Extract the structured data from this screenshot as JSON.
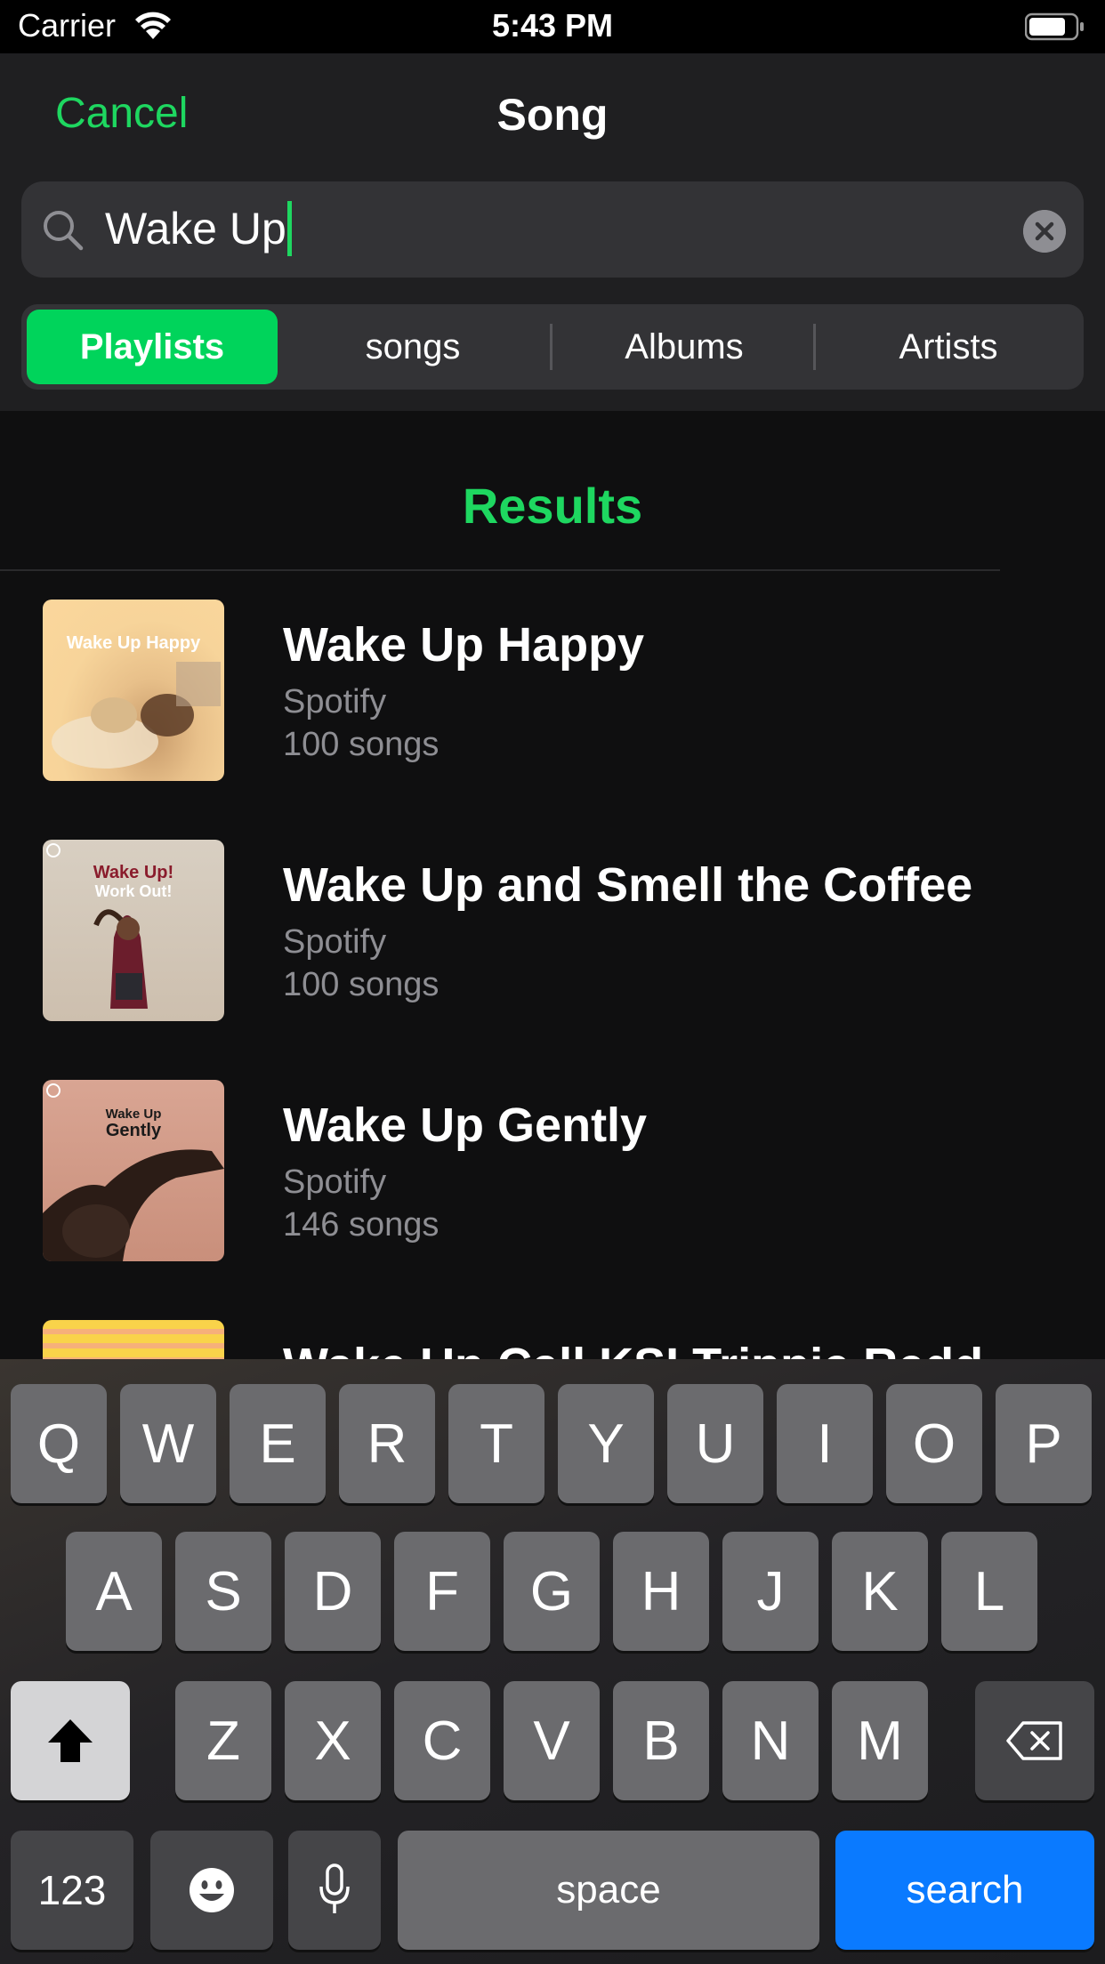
{
  "status_bar": {
    "carrier": "Carrier",
    "time": "5:43 PM"
  },
  "header": {
    "cancel_label": "Cancel",
    "title": "Song"
  },
  "search": {
    "value": "Wake Up"
  },
  "segments": {
    "items": [
      "Playlists",
      "songs",
      "Albums",
      "Artists"
    ],
    "active": "Playlists"
  },
  "results": {
    "title": "Results",
    "items": [
      {
        "title": "Wake Up Happy",
        "owner": "Spotify",
        "count": "100 songs",
        "cover_text": "Wake Up Happy"
      },
      {
        "title": "Wake Up and Smell the Coffee",
        "owner": "Spotify",
        "count": "100 songs",
        "cover_text_1": "Wake Up!",
        "cover_text_2": "Work Out!"
      },
      {
        "title": "Wake Up Gently",
        "owner": "Spotify",
        "count": "146 songs",
        "cover_text_1": "Wake Up",
        "cover_text_2": "Gently"
      },
      {
        "title": "Wake Up Call KSI Trippie Redd"
      }
    ]
  },
  "keyboard": {
    "row1": [
      "Q",
      "W",
      "E",
      "R",
      "T",
      "Y",
      "U",
      "I",
      "O",
      "P"
    ],
    "row2": [
      "A",
      "S",
      "D",
      "F",
      "G",
      "H",
      "J",
      "K",
      "L"
    ],
    "row3": [
      "Z",
      "X",
      "C",
      "V",
      "B",
      "N",
      "M"
    ],
    "numbers_label": "123",
    "space_label": "space",
    "search_label": "search"
  },
  "colors": {
    "accent": "#1ed760",
    "segment_active": "#00d45b",
    "search_key": "#0a7aff"
  }
}
